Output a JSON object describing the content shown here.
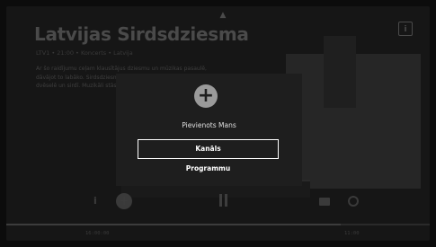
{
  "program": {
    "title": "Latvijas Sirdsdziesma",
    "subtitle": "LTV1 • 21:00 • Koncerts • Latvija",
    "description": "Ar šo raidījumu ceļam klausītājus dziesmu un mūzikas pasaulē, dāvājot to labāko. Sirdsdziesma ir dziesma, kas skan mūsu dvēselē un sirdī. Muzikāli stāsti un atmiņas ar mūzikas ziedu."
  },
  "dialog": {
    "message": "Pievienots Mans",
    "options": [
      "Kanāls",
      "Programmu"
    ],
    "selected": "Kanāls"
  },
  "player": {
    "time_start": "16:00:00",
    "time_end": "11:00",
    "progress_fraction": 0.79
  },
  "icons": [
    "chevron-up-icon",
    "info-icon",
    "plus-circle-icon",
    "pause-icon",
    "chat-icon",
    "settings-icon"
  ]
}
